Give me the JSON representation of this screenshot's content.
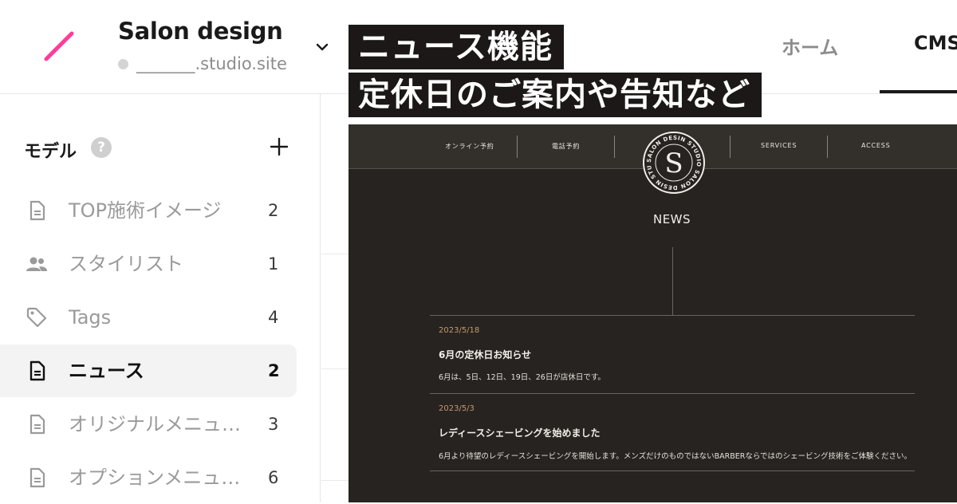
{
  "app": {
    "site_title": "Salon design",
    "site_url": "_______.studio.site",
    "colors": {
      "logo_accent": "#ff3d9a",
      "active_tab_underline": "#1a1a1a"
    }
  },
  "topnav": {
    "tabs": [
      {
        "label": "ホーム",
        "active": false
      },
      {
        "label": "CMS",
        "active": true
      }
    ]
  },
  "headline": {
    "line1": "ニュース機能",
    "line2": "定休日のご案内や告知など"
  },
  "sidebar": {
    "title": "モデル",
    "help_icon": "?",
    "add_icon": "+",
    "items": [
      {
        "label": "TOP施術イメージ",
        "count": "2",
        "icon": "document-icon",
        "active": false
      },
      {
        "label": "スタイリスト",
        "count": "1",
        "icon": "people-icon",
        "active": false
      },
      {
        "label": "Tags",
        "count": "4",
        "icon": "tag-icon",
        "active": false
      },
      {
        "label": "ニュース",
        "count": "2",
        "icon": "document-icon",
        "active": true
      },
      {
        "label": "オリジナルメニュ…",
        "count": "3",
        "icon": "document-icon",
        "active": false
      },
      {
        "label": "オプションメニュ…",
        "count": "6",
        "icon": "document-icon",
        "active": false
      }
    ]
  },
  "preview": {
    "nav": {
      "online": "オンライン予約",
      "phone": "電話予約",
      "services": "SERVICES",
      "access": "ACCESS"
    },
    "logo": {
      "ring_text": "SALON DESIN STUDIO SALON DESIN STUDIO",
      "letter": "S"
    },
    "news_heading": "NEWS",
    "posts": [
      {
        "date": "2023/5/18",
        "title": "6月の定休日お知らせ",
        "body": "6月は、5日、12日、19日、26日が店休日です。"
      },
      {
        "date": "2023/5/3",
        "title": "レディースシェービングを始めました",
        "body": "6月より待望のレディースシェービングを開始します。メンズだけのものではないBARBERならではのシェービング技術をご体験ください。"
      }
    ]
  }
}
